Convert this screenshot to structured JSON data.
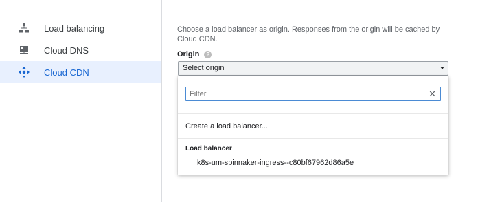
{
  "sidebar": {
    "items": [
      {
        "label": "Load balancing",
        "icon": "network-tree-icon",
        "active": false
      },
      {
        "label": "Cloud DNS",
        "icon": "dns-server-icon",
        "active": false
      },
      {
        "label": "Cloud CDN",
        "icon": "cdn-arrows-icon",
        "active": true
      }
    ]
  },
  "main": {
    "description": "Choose a load balancer as origin. Responses from the origin will be cached by Cloud CDN.",
    "origin_label": "Origin",
    "help_icon_glyph": "?",
    "select": {
      "value": "Select origin"
    },
    "dropdown": {
      "filter": {
        "placeholder": "Filter",
        "value": "",
        "clear_glyph": "✕"
      },
      "create_label": "Create a load balancer...",
      "group_label": "Load balancer",
      "options": [
        "k8s-um-spinnaker-ingress--c80bf67962d86a5e"
      ]
    }
  },
  "colors": {
    "active_bg": "#e8f0fe",
    "active_text": "#1967d2",
    "focus_border": "#4b8bd4"
  }
}
